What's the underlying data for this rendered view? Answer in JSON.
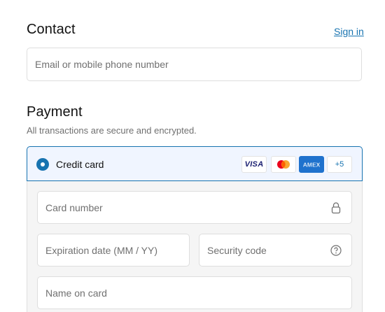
{
  "contact": {
    "title": "Contact",
    "sign_in_label": "Sign in",
    "email_placeholder": "Email or mobile phone number"
  },
  "payment": {
    "title": "Payment",
    "subtitle": "All transactions are secure and encrypted.",
    "method": {
      "label": "Credit card",
      "selected": true,
      "brands": [
        {
          "name": "VISA",
          "icon": "visa-icon"
        },
        {
          "name": "Mastercard",
          "icon": "mastercard-icon"
        },
        {
          "name": "AMEX",
          "icon": "amex-icon"
        }
      ],
      "more_brands": "+5"
    },
    "fields": {
      "card_number_placeholder": "Card number",
      "expiration_placeholder": "Expiration date (MM / YY)",
      "security_code_placeholder": "Security code",
      "name_on_card_placeholder": "Name on card"
    }
  },
  "colors": {
    "accent": "#1773b0",
    "selected_background": "#f0f5ff",
    "panel_background": "#f5f5f5",
    "border": "#dedede",
    "placeholder_text": "#707070"
  }
}
